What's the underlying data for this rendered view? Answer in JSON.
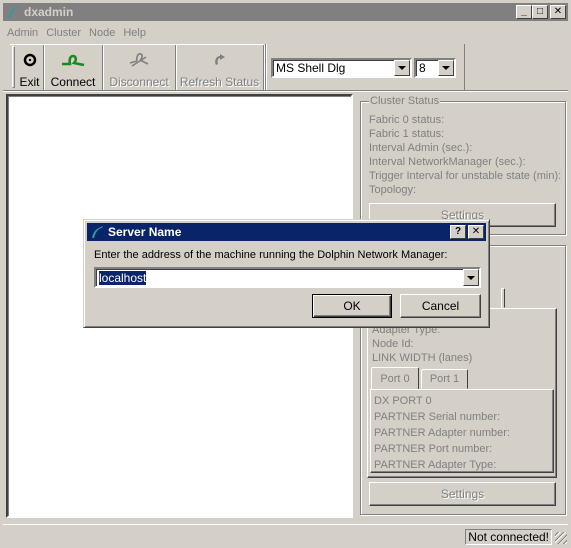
{
  "window": {
    "title": "dxadmin",
    "controls": {
      "minimize": "_",
      "maximize": "□",
      "close": "✕"
    }
  },
  "menu": [
    "Admin",
    "Cluster",
    "Node",
    "Help"
  ],
  "toolbar": {
    "buttons": [
      {
        "label": "Exit",
        "icon": "exit-icon",
        "enabled": true
      },
      {
        "label": "Connect",
        "icon": "connect-icon",
        "enabled": true
      },
      {
        "label": "Disconnect",
        "icon": "disconnect-icon",
        "enabled": false
      },
      {
        "label": "Refresh Status",
        "icon": "refresh-icon",
        "enabled": false
      }
    ],
    "font_select": {
      "value": "MS Shell Dlg"
    },
    "size_select": {
      "value": "8"
    }
  },
  "cluster_status": {
    "title": "Cluster Status",
    "fields": [
      "Fabric 0 status:",
      "Fabric 1 status:",
      "Interval Admin (sec.):",
      "Interval NetworkManager (sec.):",
      "Trigger Interval for unstable state (min):",
      "Topology:"
    ],
    "settings_label": "Settings"
  },
  "node_status": {
    "fields": [
      "Adapter Type:",
      "Node Id:",
      "LINK WIDTH (lanes)"
    ],
    "port_tabs": [
      "Port 0",
      "Port 1"
    ],
    "port_fields": [
      "DX PORT 0",
      "PARTNER Serial number:",
      "PARTNER Adapter number:",
      "PARTNER Port number:",
      "PARTNER Adapter Type:"
    ],
    "settings_label": "Settings"
  },
  "status_bar": {
    "text": "Not connected!"
  },
  "dialog": {
    "title": "Server Name",
    "help": "?",
    "close": "✕",
    "prompt": "Enter the address of the machine running the Dolphin Network Manager:",
    "input_value": "localhost",
    "ok_label": "OK",
    "cancel_label": "Cancel"
  },
  "colors": {
    "inactive_title": "#808080",
    "active_title": "#0a246a",
    "face": "#d4d0c8",
    "connect_green": "#1a8a1a"
  }
}
